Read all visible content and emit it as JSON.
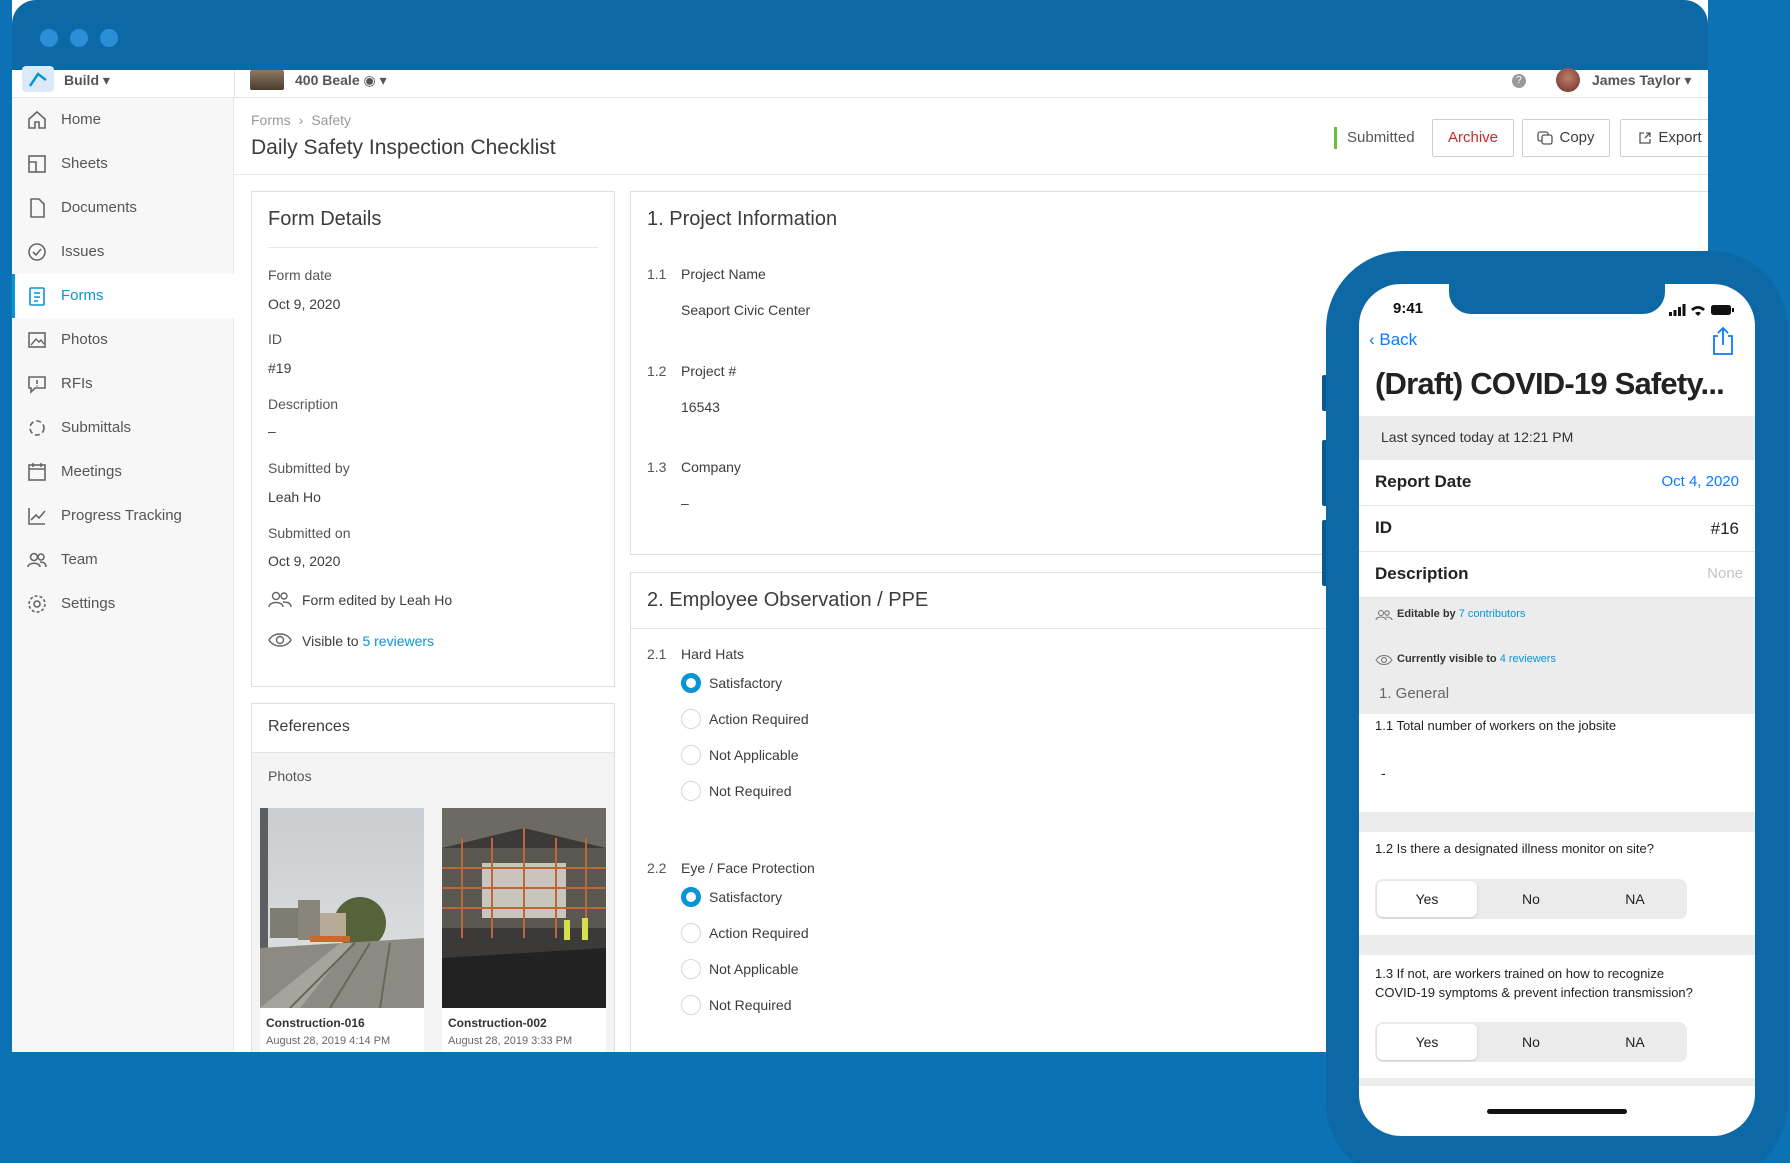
{
  "topbar": {
    "app": "Build",
    "project": "400 Beale",
    "user": "James Taylor"
  },
  "sidebar": {
    "items": [
      {
        "label": "Home",
        "icon": "home-icon"
      },
      {
        "label": "Sheets",
        "icon": "sheets-icon"
      },
      {
        "label": "Documents",
        "icon": "document-icon"
      },
      {
        "label": "Issues",
        "icon": "issues-icon"
      },
      {
        "label": "Forms",
        "icon": "forms-icon",
        "active": true
      },
      {
        "label": "Photos",
        "icon": "photos-icon"
      },
      {
        "label": "RFIs",
        "icon": "rfi-icon"
      },
      {
        "label": "Submittals",
        "icon": "submittals-icon"
      },
      {
        "label": "Meetings",
        "icon": "meetings-icon"
      },
      {
        "label": "Progress Tracking",
        "icon": "chart-icon"
      },
      {
        "label": "Team",
        "icon": "team-icon"
      },
      {
        "label": "Settings",
        "icon": "gear-icon"
      }
    ]
  },
  "header": {
    "breadcrumb": [
      "Forms",
      "Safety"
    ],
    "title": "Daily Safety Inspection Checklist",
    "status": "Submitted",
    "archive": "Archive",
    "copy": "Copy",
    "export": "Export"
  },
  "form_details": {
    "title": "Form Details",
    "form_date_label": "Form date",
    "form_date": "Oct 9, 2020",
    "id_label": "ID",
    "id": "#19",
    "description_label": "Description",
    "description": "–",
    "submitted_by_label": "Submitted by",
    "submitted_by": "Leah Ho",
    "submitted_on_label": "Submitted on",
    "submitted_on": "Oct 9, 2020",
    "edited_by": "Form edited by Leah Ho",
    "visible_prefix": "Visible to ",
    "visible_link": "5 reviewers"
  },
  "references": {
    "title": "References",
    "photos_label": "Photos",
    "photos": [
      {
        "name": "Construction-016",
        "date": "August 28, 2019 4:14 PM"
      },
      {
        "name": "Construction-002",
        "date": "August 28, 2019 3:33 PM"
      }
    ]
  },
  "section1": {
    "title": "1. Project Information",
    "q1_num": "1.1",
    "q1_label": "Project Name",
    "q1_answer": "Seaport Civic Center",
    "q2_num": "1.2",
    "q2_label": "Project #",
    "q2_answer": "16543",
    "q3_num": "1.3",
    "q3_label": "Company",
    "q3_answer": "–"
  },
  "section2": {
    "title": "2. Employee Observation / PPE",
    "q1_num": "2.1",
    "q1_label": "Hard Hats",
    "q2_num": "2.2",
    "q2_label": "Eye / Face Protection",
    "options": [
      "Satisfactory",
      "Action Required",
      "Not Applicable",
      "Not Required"
    ],
    "q1_selected": "Satisfactory",
    "q2_selected": "Satisfactory"
  },
  "phone": {
    "time": "9:41",
    "back": "Back",
    "title": "(Draft) COVID-19 Safety...",
    "synced": "Last synced today at 12:21 PM",
    "report_date_label": "Report Date",
    "report_date": "Oct 4, 2020",
    "id_label": "ID",
    "id": "#16",
    "description_label": "Description",
    "description": "None",
    "editable_prefix": "Editable by ",
    "editable_link": "7 contributors",
    "visible_prefix": "Currently visible to ",
    "visible_link": "4 reviewers",
    "section": "1. General",
    "q1": "1.1 Total number of workers on the jobsite",
    "q1_answer": "-",
    "q2": "1.2 Is there a designated illness monitor on site?",
    "q3_line1": "1.3 If not, are workers trained on how to recognize",
    "q3_line2": "COVID-19 symptoms & prevent infection transmission?",
    "seg_yes": "Yes",
    "seg_no": "No",
    "seg_na": "NA",
    "accent": "#0a7bff"
  },
  "colors": {
    "accent": "#0696d7",
    "background": "#0a72b5",
    "archive": "#c9292e",
    "submitted": "#6abf40"
  }
}
